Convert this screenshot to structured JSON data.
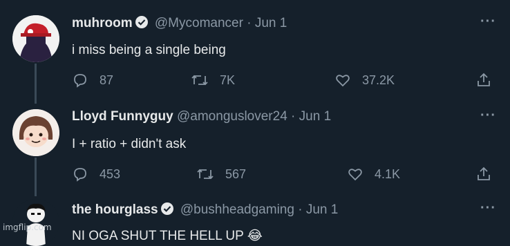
{
  "tweets": [
    {
      "name": "muhroom",
      "verified": true,
      "handle": "@Mycomancer",
      "date": "Jun 1",
      "text": "i miss being a single being",
      "replies": "87",
      "retweets": "7K",
      "likes": "37.2K"
    },
    {
      "name": "Lloyd Funnyguy",
      "verified": false,
      "handle": "@amonguslover24",
      "date": "Jun 1",
      "text": "I + ratio + didn't ask",
      "replies": "453",
      "retweets": "567",
      "likes": "4.1K"
    },
    {
      "name": "the hourglass",
      "verified": true,
      "handle": "@bushheadgaming",
      "date": "Jun 1",
      "text": "NI OGA SHUT THE HELL UP 😂"
    }
  ],
  "separator": "·",
  "more_label": "···",
  "watermark": "imgflip.com",
  "icons": {
    "reply": "reply-icon",
    "retweet": "retweet-icon",
    "like": "heart-icon",
    "share": "share-icon",
    "verified": "verified-badge-icon",
    "more": "more-options-icon"
  },
  "colors": {
    "background": "#15202b",
    "text": "#e7e9ea",
    "muted": "#8b98a5",
    "thread_line": "#3a4a58"
  }
}
